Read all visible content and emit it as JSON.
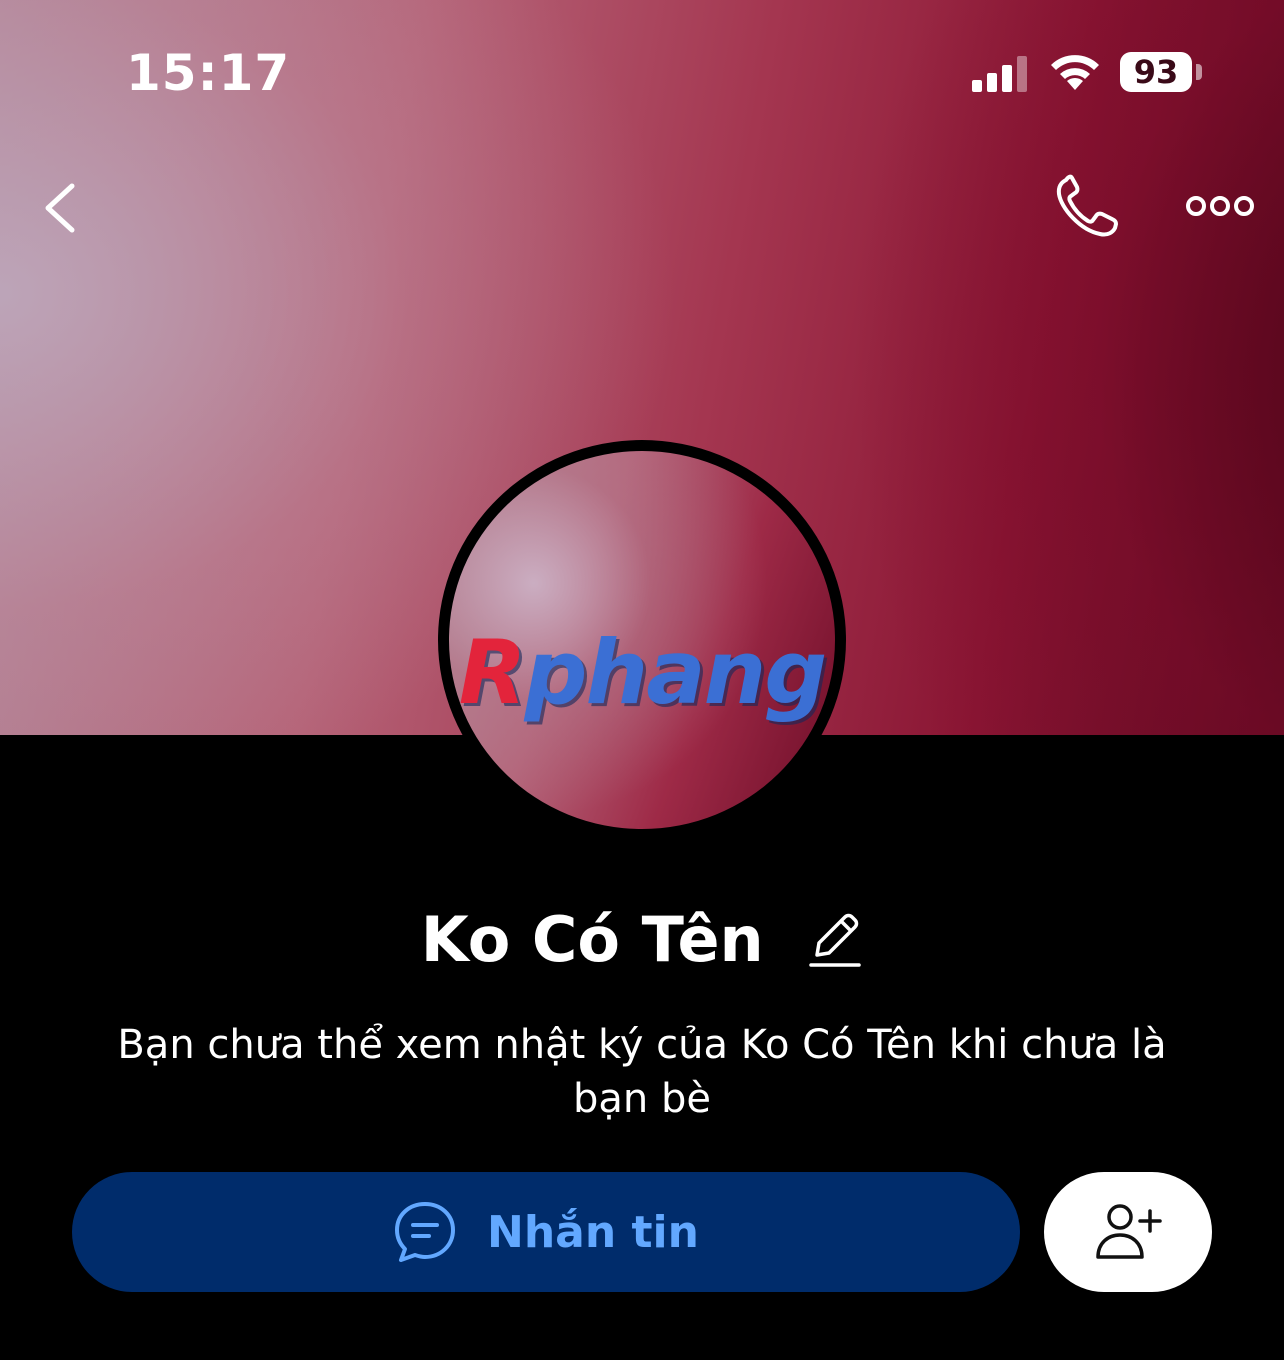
{
  "status_bar": {
    "time": "15:17",
    "battery_level": "93",
    "signal_bars_active": 3,
    "signal_bars_total": 4,
    "icons": [
      "cellular-signal-icon",
      "wifi-icon",
      "battery-icon"
    ]
  },
  "header": {
    "icons": [
      "chevron-left-icon",
      "phone-icon",
      "more-horizontal-icon"
    ]
  },
  "profile": {
    "avatar_watermark": "Rphang",
    "name": "Ko Có Tên",
    "edit_icon": "pencil-icon",
    "notice": "Bạn chưa thể xem nhật ký của Ko Có Tên khi chưa là bạn bè"
  },
  "actions": {
    "message_label": "Nhắn tin",
    "message_icon": "chat-bubble-icon",
    "add_friend_icon": "user-plus-icon"
  },
  "colors": {
    "background": "#000000",
    "message_button_bg": "#002c6b",
    "message_button_text": "#62a8ff",
    "add_friend_button_bg": "#ffffff"
  }
}
